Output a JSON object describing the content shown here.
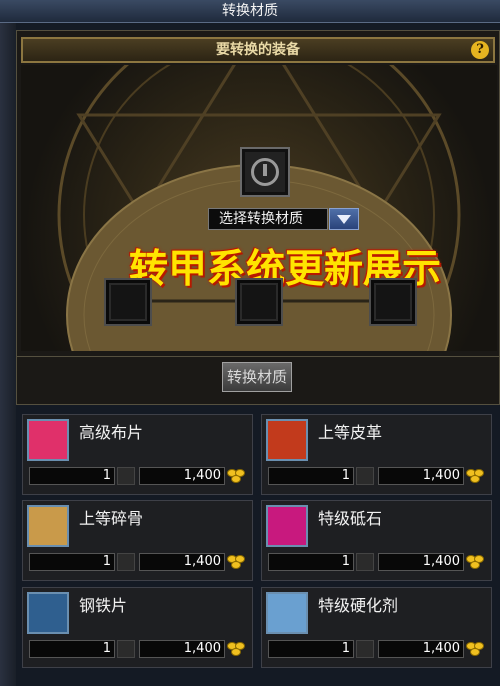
{
  "window": {
    "title": "转换材质"
  },
  "panel": {
    "header": "要转换的装备",
    "help_icon": "?",
    "select_label": "选择转换材质",
    "banner": "转甲系统更新展示",
    "convert_button": "转换材质"
  },
  "materials": [
    {
      "name": "高级布片",
      "qty": "1",
      "price": "1,400",
      "icon": "cloth-icon",
      "color": "#e0306a"
    },
    {
      "name": "上等皮革",
      "qty": "1",
      "price": "1,400",
      "icon": "leather-icon",
      "color": "#c23a1c"
    },
    {
      "name": "上等碎骨",
      "qty": "1",
      "price": "1,400",
      "icon": "bone-icon",
      "color": "#c99a4a"
    },
    {
      "name": "特级砥石",
      "qty": "1",
      "price": "1,400",
      "icon": "whetstone-icon",
      "color": "#c8197e"
    },
    {
      "name": "钢铁片",
      "qty": "1",
      "price": "1,400",
      "icon": "steel-icon",
      "color": "#2f5f8f"
    },
    {
      "name": "特级硬化剂",
      "qty": "1",
      "price": "1,400",
      "icon": "hardener-icon",
      "color": "#6aa0d0"
    }
  ],
  "colors": {
    "banner": "#ffe400",
    "banner_outline": "#b21a00",
    "gold": "#f0c020"
  }
}
